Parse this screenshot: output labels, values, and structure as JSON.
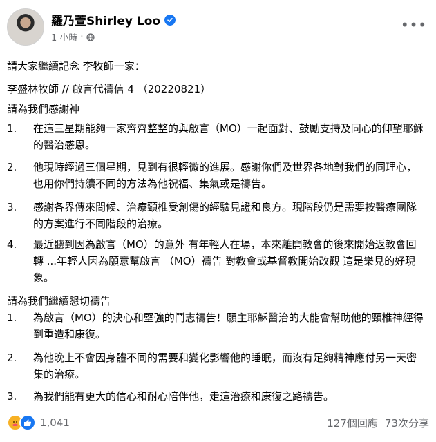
{
  "post": {
    "author": "羅乃萱Shirley Loo",
    "time": "1 小時",
    "meta_separator": "·",
    "intro": "請大家繼續記念 李牧師一家：",
    "letter_title": "李盛林牧師 // 啟言代禱信 4 （20220821）",
    "thanks_heading": "請為我們感謝神",
    "thanks_items": [
      {
        "num": "1.",
        "text": "在這三星期能夠一家齊齊整整的與啟言（MO）一起面對、鼓勵支持及同心的仰望耶穌的醫治感恩。"
      },
      {
        "num": "2.",
        "text": "他現時經過三個星期，見到有很輕微的進展。感謝你們及世界各地對我們的同理心，也用你們持續不同的方法為他祝福、集氣或是禱告。"
      },
      {
        "num": "3.",
        "text": "感謝各界傳來問候、治療頸椎受創傷的經驗見證和良方。現階段仍是需要按醫療團隊的方案進行不同階段的治療。"
      },
      {
        "num": "4.",
        "text": "最近聽到因為啟言（MO）的意外 有年輕人在場，本來離開教會的後來開始返教會回轉 ...年輕人因為願意幫啟言 （MO）禱告 對教會或基督教開始改觀 這是樂見的好現象。"
      }
    ],
    "prayer_heading": "請為我們繼續懇切禱告",
    "prayer_items": [
      {
        "num": "1.",
        "text": "為啟言（MO）的決心和堅強的鬥志禱告！願主耶穌醫治的大能會幫助他的頸椎神經得到重造和康復。"
      },
      {
        "num": "2.",
        "text": "為他晚上不會因身體不同的需要和變化影響他的睡眠，而沒有足夠精神應付另一天密集的治療。"
      },
      {
        "num": "3.",
        "text": "為我們能有更大的信心和耐心陪伴他，走這治療和康復之路禱告。"
      }
    ]
  },
  "footer": {
    "reaction_count": "1,041",
    "comments": "127個回應",
    "shares": "73次分享"
  },
  "icons": {
    "verified": "verified-badge-icon",
    "globe": "globe-icon",
    "more": "more-options-icon",
    "care": "care-reaction-icon",
    "like": "like-reaction-icon"
  },
  "colors": {
    "accent": "#1877f2",
    "secondary_text": "#65676b",
    "care": "#f7b125"
  }
}
